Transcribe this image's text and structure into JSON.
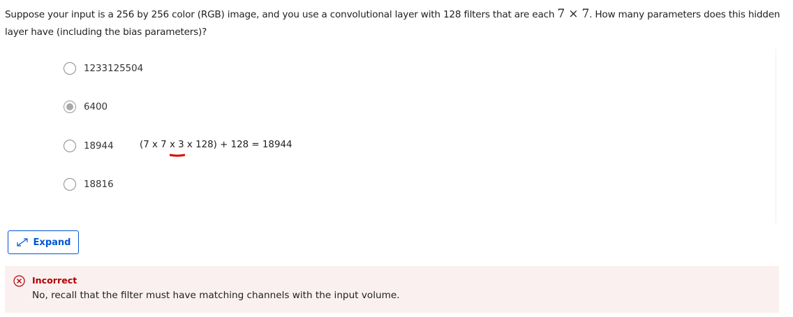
{
  "question": {
    "text_before": "Suppose your input is a 256 by 256 color (RGB) image, and you use a convolutional layer with 128 filters that are each ",
    "math": "7 × 7",
    "text_after": ". How many parameters does this hidden layer have (including the bias parameters)?"
  },
  "options": [
    {
      "label": "1233125504",
      "selected": false
    },
    {
      "label": "6400",
      "selected": true
    },
    {
      "label": "18944",
      "selected": false
    },
    {
      "label": "18816",
      "selected": false
    }
  ],
  "annotation": {
    "text": "(7 x 7 x 3 x 128) + 128 = 18944",
    "mark_color": "#e00000"
  },
  "expand_button": {
    "label": "Expand",
    "icon": "expand-arrows-icon"
  },
  "feedback": {
    "status": "Incorrect",
    "icon": "close-circle-icon",
    "message": "No, recall that the filter must have matching channels with the input volume.",
    "status_color": "#b00000",
    "background": "#fbf0f0"
  },
  "colors": {
    "accent": "#0056d2"
  }
}
